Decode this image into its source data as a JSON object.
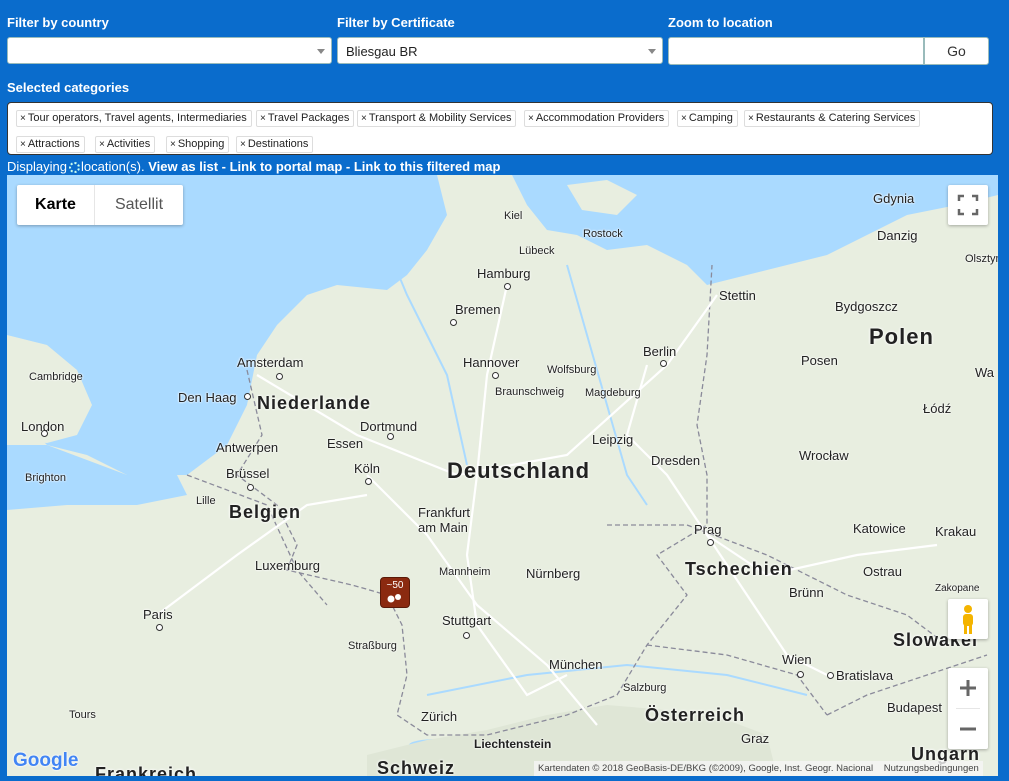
{
  "filters": {
    "country_label": "Filter by country",
    "country_value": "",
    "certificate_label": "Filter by Certificate",
    "certificate_value": "Bliesgau BR",
    "zoom_label": "Zoom to location",
    "zoom_value": "",
    "go_label": "Go"
  },
  "categories": {
    "label": "Selected categories",
    "items": [
      "Tour operators, Travel agents, Intermediaries",
      "Travel Packages",
      "Transport & Mobility Services",
      "Accommodation Providers",
      "Camping",
      "Restaurants & Catering Services",
      "Attractions",
      "Activities",
      "Shopping",
      "Destinations"
    ],
    "remove_glyph": "×"
  },
  "status": {
    "prefix": "Displaying",
    "suffix": "location(s).",
    "links": [
      "View as list",
      "Link to portal map",
      "Link to this filtered map"
    ],
    "separator": " - "
  },
  "map": {
    "type_buttons": [
      "Karte",
      "Satellit"
    ],
    "active_type": "Karte",
    "cluster_label": "~50",
    "countries": [
      "Niederlande",
      "Belgien",
      "Luxemburg",
      "Deutschland",
      "Polen",
      "Tschechien",
      "Österreich",
      "Schweiz",
      "Liechtenstein",
      "Slowakei",
      "Ungarn",
      "Frankreich"
    ],
    "cities": [
      "Kiel",
      "Rostock",
      "Gdynia",
      "Danzig",
      "Olsztyn",
      "Lübeck",
      "Hamburg",
      "Stettin",
      "Bydgoszcz",
      "Bremen",
      "Amsterdam",
      "Hannover",
      "Wolfsburg",
      "Berlin",
      "Posen",
      "Cambridge",
      "Den Haag",
      "Braunschweig",
      "Magdeburg",
      "London",
      "Dortmund",
      "Antwerpen",
      "Essen",
      "Leipzig",
      "Łódź",
      "Brüssel",
      "Köln",
      "Dresden",
      "Wrocław",
      "Brighton",
      "Lille",
      "Frankfurt am Main",
      "Prag",
      "Katowice",
      "Krakau",
      "Mannheim",
      "Nürnberg",
      "Ostrau",
      "Paris",
      "Stuttgart",
      "Brünn",
      "Zakopane",
      "Straßburg",
      "München",
      "Wien",
      "Bratislava",
      "Salzburg",
      "Tours",
      "Zürich",
      "Budapest",
      "Graz",
      "Wa"
    ],
    "attribution": "Kartendaten © 2018 GeoBasis-DE/BKG (©2009), Google, Inst. Geogr. Nacional",
    "terms": "Nutzungsbedingungen",
    "logo": "Google",
    "icons": [
      "fullscreen-icon",
      "pegman-icon",
      "zoom-in-icon",
      "zoom-out-icon"
    ],
    "colors": {
      "sea": "#aadaff",
      "land": "#e8eee0",
      "cluster": "#8b2a10",
      "panel": "#0a6ccc"
    }
  }
}
